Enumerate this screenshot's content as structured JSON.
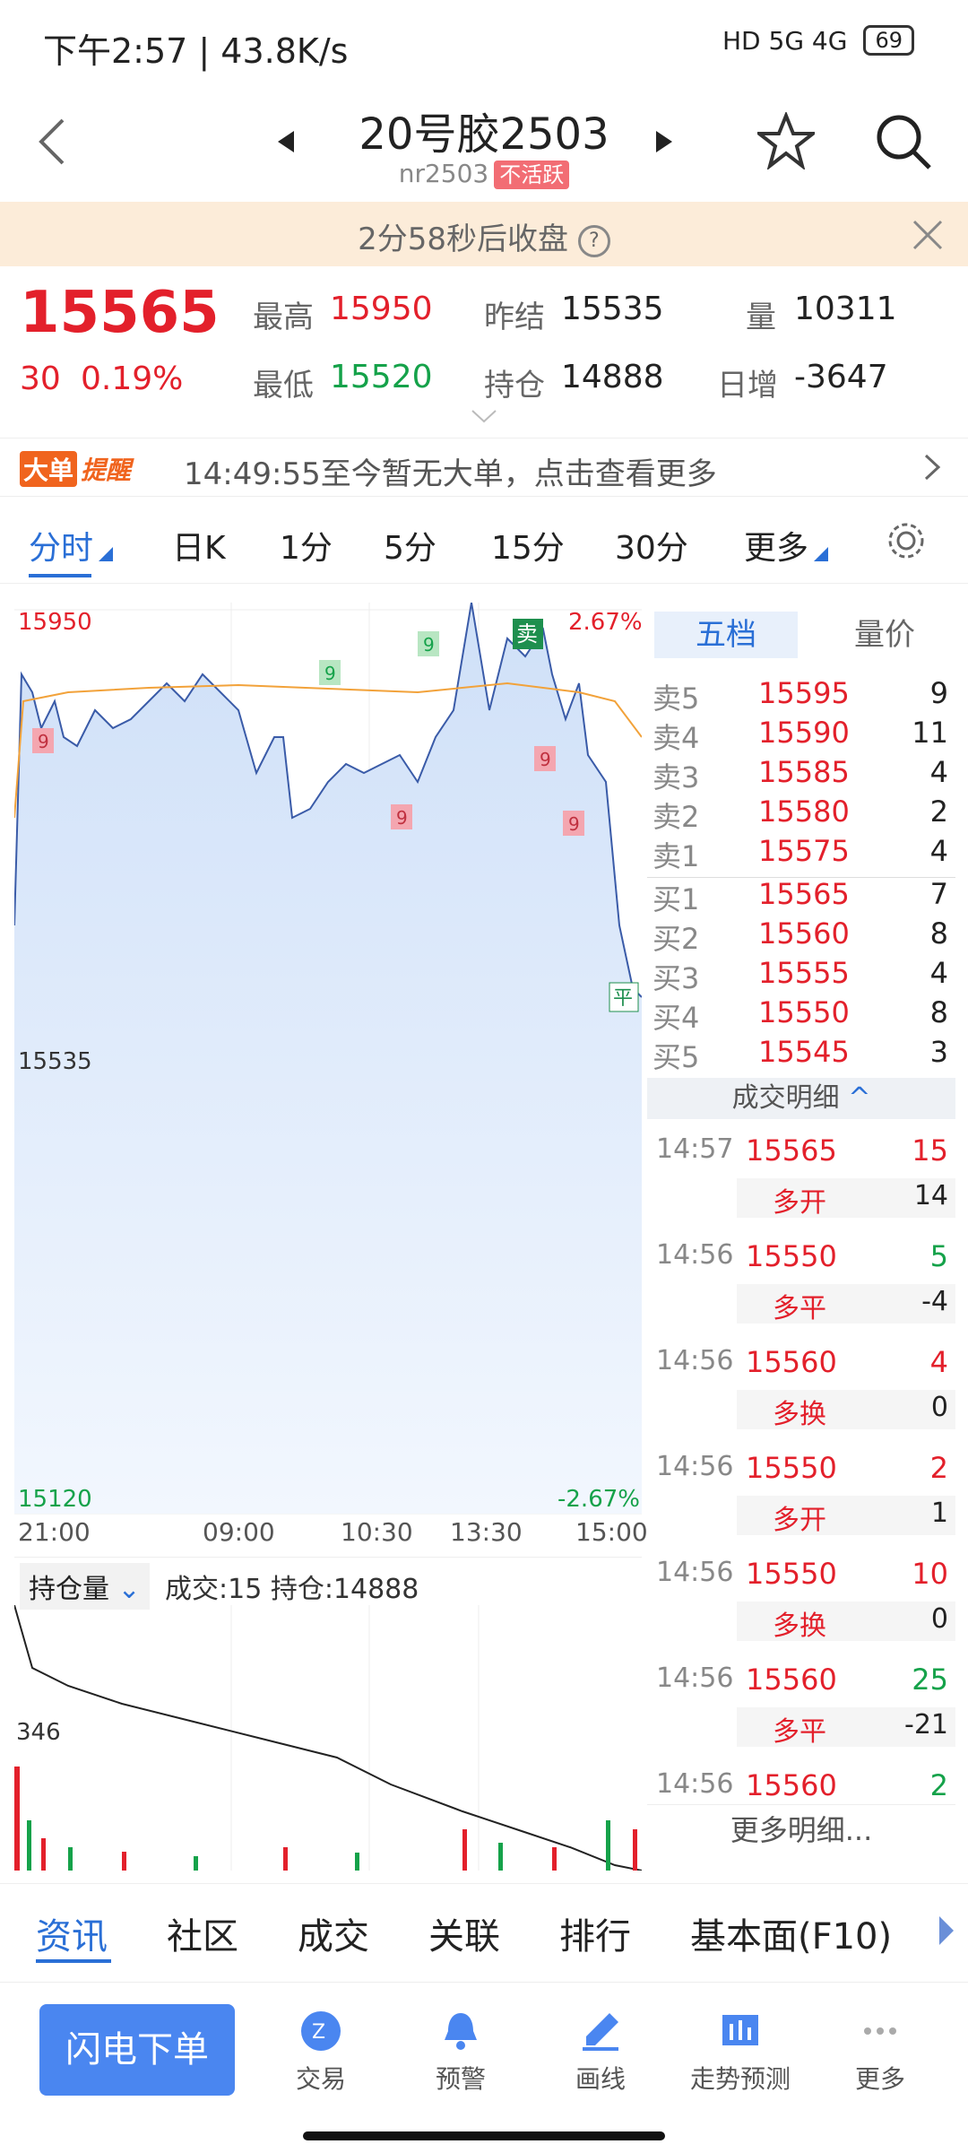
{
  "status": {
    "time": "下午2:57 | 43.8K/s",
    "sys": "HD 5G 4G",
    "battery": "69"
  },
  "header": {
    "title": "20号胶2503",
    "code": "nr2503",
    "badge": "不活跃"
  },
  "banner": {
    "text": "2分58秒后收盘"
  },
  "quote": {
    "price": "15565",
    "change": "30",
    "change_pct": "0.19%",
    "high_label": "最高",
    "high": "15950",
    "low_label": "最低",
    "low": "15520",
    "prev_label": "昨结",
    "prev": "15535",
    "oi_label": "持仓",
    "oi": "14888",
    "vol_label": "量",
    "vol": "10311",
    "daily_label": "日增",
    "daily": "-3647"
  },
  "bigorder": {
    "tag1": "大单",
    "tag2": "提醒",
    "text": "14:49:55至今暂无大单，点击查看更多"
  },
  "periods": [
    "分时",
    "日K",
    "1分",
    "5分",
    "15分",
    "30分",
    "更多"
  ],
  "chart": {
    "top_price": "15950",
    "top_pct": "2.67%",
    "mid_price": "15535",
    "bottom_price": "15120",
    "bottom_pct": "-2.67%",
    "xticks": [
      "21:00",
      "09:00",
      "10:30",
      "13:30",
      "15:00"
    ],
    "markers": {
      "sell": "卖",
      "close": "平",
      "nine": "9"
    },
    "sub_selector": "持仓量",
    "sub_info": "成交:15  持仓:14888",
    "sub_max": "346"
  },
  "book": {
    "tab1": "五档",
    "tab2": "量价",
    "sells": [
      {
        "l": "卖5",
        "p": "15595",
        "v": "9"
      },
      {
        "l": "卖4",
        "p": "15590",
        "v": "11"
      },
      {
        "l": "卖3",
        "p": "15585",
        "v": "4"
      },
      {
        "l": "卖2",
        "p": "15580",
        "v": "2"
      },
      {
        "l": "卖1",
        "p": "15575",
        "v": "4"
      }
    ],
    "buys": [
      {
        "l": "买1",
        "p": "15565",
        "v": "7"
      },
      {
        "l": "买2",
        "p": "15560",
        "v": "8"
      },
      {
        "l": "买3",
        "p": "15555",
        "v": "4"
      },
      {
        "l": "买4",
        "p": "15550",
        "v": "8"
      },
      {
        "l": "买5",
        "p": "15545",
        "v": "3"
      }
    ],
    "detail_title": "成交明细",
    "ticks": [
      {
        "t": "14:57",
        "p": "15565",
        "v": "15",
        "k": "多开",
        "d": "14",
        "vc": "red"
      },
      {
        "t": "14:56",
        "p": "15550",
        "v": "5",
        "k": "多平",
        "d": "-4",
        "vc": "green"
      },
      {
        "t": "14:56",
        "p": "15560",
        "v": "4",
        "k": "多换",
        "d": "0",
        "vc": "red"
      },
      {
        "t": "14:56",
        "p": "15550",
        "v": "2",
        "k": "多开",
        "d": "1",
        "vc": "red"
      },
      {
        "t": "14:56",
        "p": "15550",
        "v": "10",
        "k": "多换",
        "d": "0",
        "vc": "red"
      },
      {
        "t": "14:56",
        "p": "15560",
        "v": "25",
        "k": "多平",
        "d": "-21",
        "vc": "green"
      },
      {
        "t": "14:56",
        "p": "15560",
        "v": "2",
        "k": "",
        "d": "",
        "vc": "green"
      }
    ],
    "more": "更多明细..."
  },
  "bottomtabs": [
    "资讯",
    "社区",
    "成交",
    "关联",
    "排行",
    "基本面(F10)"
  ],
  "toolbar": {
    "flash": "闪电下单",
    "items": [
      "交易",
      "预警",
      "画线",
      "走势预测",
      "更多"
    ]
  }
}
